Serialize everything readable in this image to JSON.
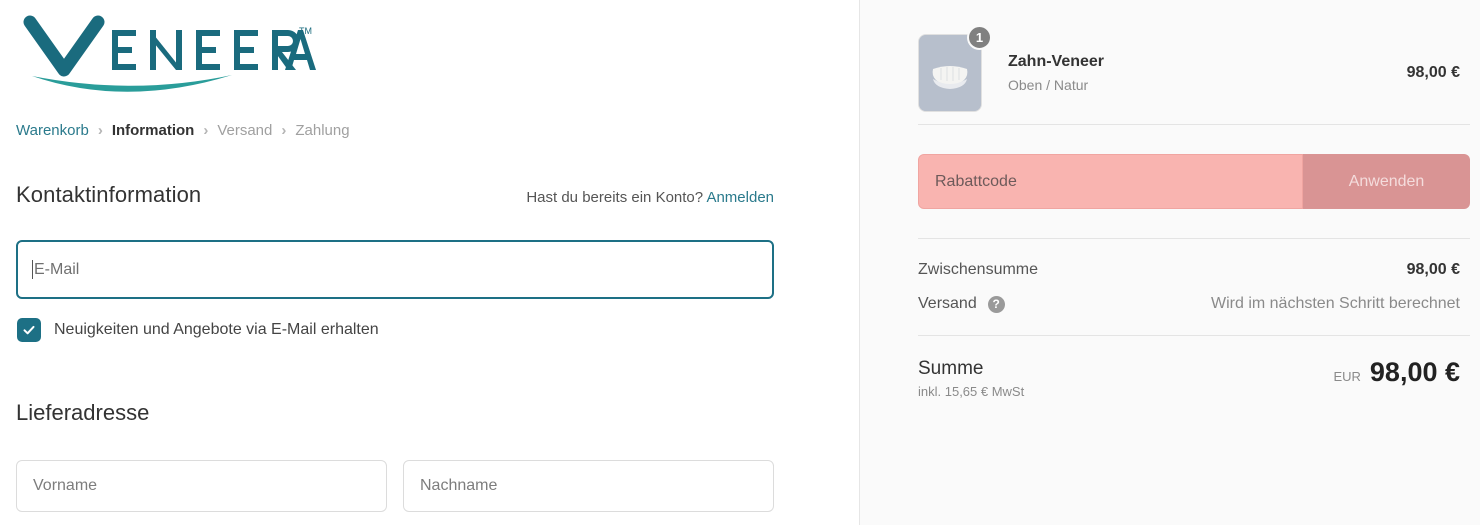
{
  "brand": {
    "name": "VENEERA",
    "trademark": "TM",
    "logo_color": "#1a6b7e",
    "swoosh_color": "#2a9d9a"
  },
  "breadcrumb": {
    "items": [
      {
        "label": "Warenkorb",
        "state": "link"
      },
      {
        "label": "Information",
        "state": "current"
      },
      {
        "label": "Versand",
        "state": "muted"
      },
      {
        "label": "Zahlung",
        "state": "muted"
      }
    ],
    "separator": "›"
  },
  "contact": {
    "title": "Kontaktinformation",
    "account_prompt": "Hast du bereits ein Konto?",
    "login_link": "Anmelden",
    "email": {
      "placeholder": "E-Mail",
      "value": ""
    },
    "newsletter_label": "Neuigkeiten und Angebote via E-Mail erhalten",
    "newsletter_checked": true
  },
  "delivery": {
    "title": "Lieferadresse",
    "first_name": {
      "placeholder": "Vorname",
      "value": ""
    },
    "last_name": {
      "placeholder": "Nachname",
      "value": ""
    }
  },
  "summary": {
    "line_item": {
      "name": "Zahn-Veneer",
      "variant": "Oben / Natur",
      "quantity": "1",
      "price": "98,00 €"
    },
    "discount": {
      "placeholder": "Rabattcode",
      "value": "",
      "apply_label": "Anwenden",
      "field_color": "#f9b4b0",
      "button_color": "#d99494"
    },
    "subtotal": {
      "label": "Zwischensumme",
      "value": "98,00 €"
    },
    "shipping": {
      "label": "Versand",
      "help_glyph": "?",
      "value": "Wird im nächsten Schritt berechnet"
    },
    "total": {
      "label": "Summe",
      "tax_note": "inkl. 15,65 € MwSt",
      "currency": "EUR",
      "amount": "98,00 €"
    }
  }
}
